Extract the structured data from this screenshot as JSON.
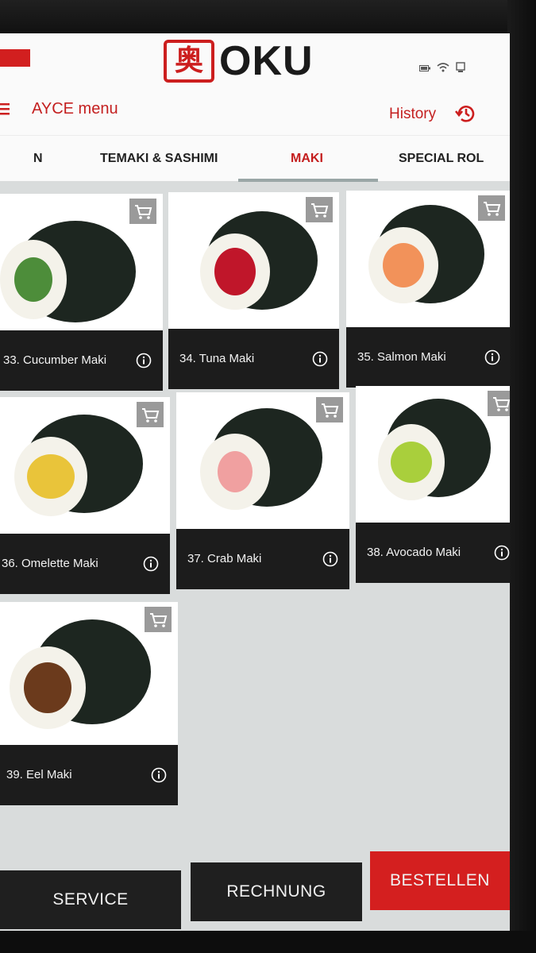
{
  "header": {
    "logo_mark": "奥",
    "logo_text": "OKU",
    "status_icons": [
      "battery-icon",
      "wifi-icon",
      "device-icon"
    ],
    "menu_label": "AYCE menu",
    "history_label": "History"
  },
  "tabs": [
    {
      "label": "N"
    },
    {
      "label": "TEMAKI & SASHIMI"
    },
    {
      "label": "MAKI",
      "active": true
    },
    {
      "label": "SPECIAL ROL"
    }
  ],
  "items": [
    {
      "label": "33. Cucumber Maki",
      "filling": "#4d8d3a"
    },
    {
      "label": "34. Tuna Maki",
      "filling": "#c0162a"
    },
    {
      "label": "35.  Salmon Maki",
      "filling": "#f2925a"
    },
    {
      "label": "36. Omelette Maki",
      "filling": "#e9c43a"
    },
    {
      "label": "37. Crab Maki",
      "filling": "#f0a0a0"
    },
    {
      "label": "38. Avocado Maki",
      "filling": "#a9cf3c"
    },
    {
      "label": "39. Eel Maki",
      "filling": "#6b3a1c"
    }
  ],
  "buttons": {
    "service": "SERVICE",
    "rechnung": "RECHNUNG",
    "bestellen": "BESTELLEN"
  },
  "colors": {
    "brand_red": "#cc1e1e",
    "caption_bg": "#1c1c1c",
    "screen_bg": "#d9dcdc"
  }
}
